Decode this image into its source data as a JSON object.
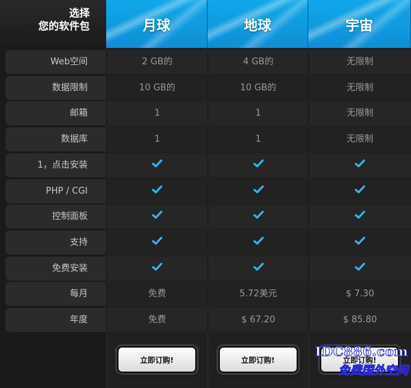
{
  "header": {
    "corner_line1": "选择",
    "corner_line2": "您的软件包",
    "plans": [
      "月球",
      "地球",
      "宇宙"
    ]
  },
  "rows": [
    {
      "label": "Web空间",
      "values": [
        "2 GB的",
        "4 GB的",
        "无限制"
      ]
    },
    {
      "label": "数据限制",
      "values": [
        "10 GB的",
        "10 GB的",
        "无限制"
      ]
    },
    {
      "label": "邮箱",
      "values": [
        "1",
        "1",
        "无限制"
      ]
    },
    {
      "label": "数据库",
      "values": [
        "1",
        "1",
        "无限制"
      ]
    },
    {
      "label": "1，点击安装",
      "values": [
        "check",
        "check",
        "check"
      ]
    },
    {
      "label": "PHP / CGI",
      "values": [
        "check",
        "check",
        "check"
      ]
    },
    {
      "label": "控制面板",
      "values": [
        "check",
        "check",
        "check"
      ]
    },
    {
      "label": "支持",
      "values": [
        "check",
        "check",
        "check"
      ]
    },
    {
      "label": "免费安装",
      "values": [
        "check",
        "check",
        "check"
      ]
    },
    {
      "label": "每月",
      "values": [
        "免费",
        "5.72美元",
        "$ 7.30"
      ]
    },
    {
      "label": "年度",
      "values": [
        "免费",
        "$ 67.20",
        "$ 85.80"
      ]
    }
  ],
  "buttons": {
    "order_label": "立即订购!"
  },
  "watermark": {
    "line1": "IDC886.com",
    "line2": "免费国外空间"
  },
  "colors": {
    "header_blue": "#10a7ea",
    "check_blue": "#2fb8ee"
  }
}
